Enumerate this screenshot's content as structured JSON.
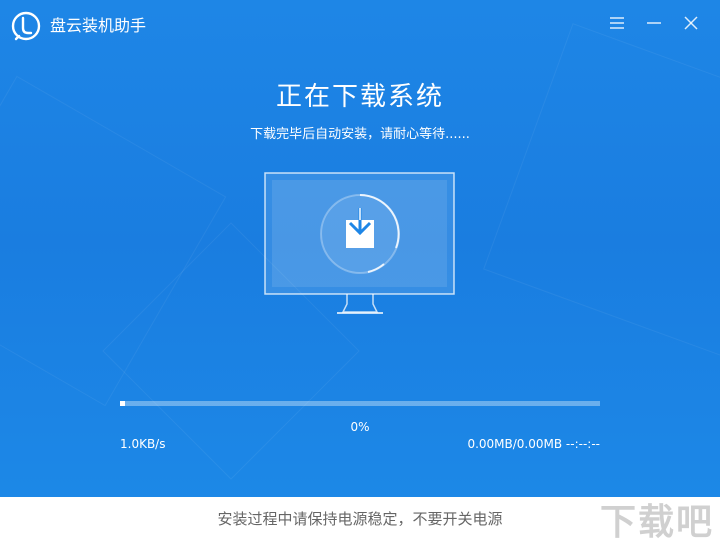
{
  "window": {
    "title": "盘云装机助手",
    "accent_color": "#1e86e6",
    "controls": [
      {
        "name": "menu-icon"
      },
      {
        "name": "minimize-icon"
      },
      {
        "name": "close-icon"
      }
    ]
  },
  "main": {
    "headline": "正在下载系统",
    "subline": "下载完毕后自动安装，请耐心等待......",
    "illustration_icon": "monitor-download-icon",
    "progress": {
      "percent_value": 0.01,
      "percent_label": "0%",
      "speed": "1.0KB/s",
      "size_and_eta": "0.00MB/0.00MB  --:--:--"
    }
  },
  "footer": {
    "notice": "安装过程中请保持电源稳定，不要开关电源"
  },
  "watermark": {
    "text": "下载吧"
  }
}
